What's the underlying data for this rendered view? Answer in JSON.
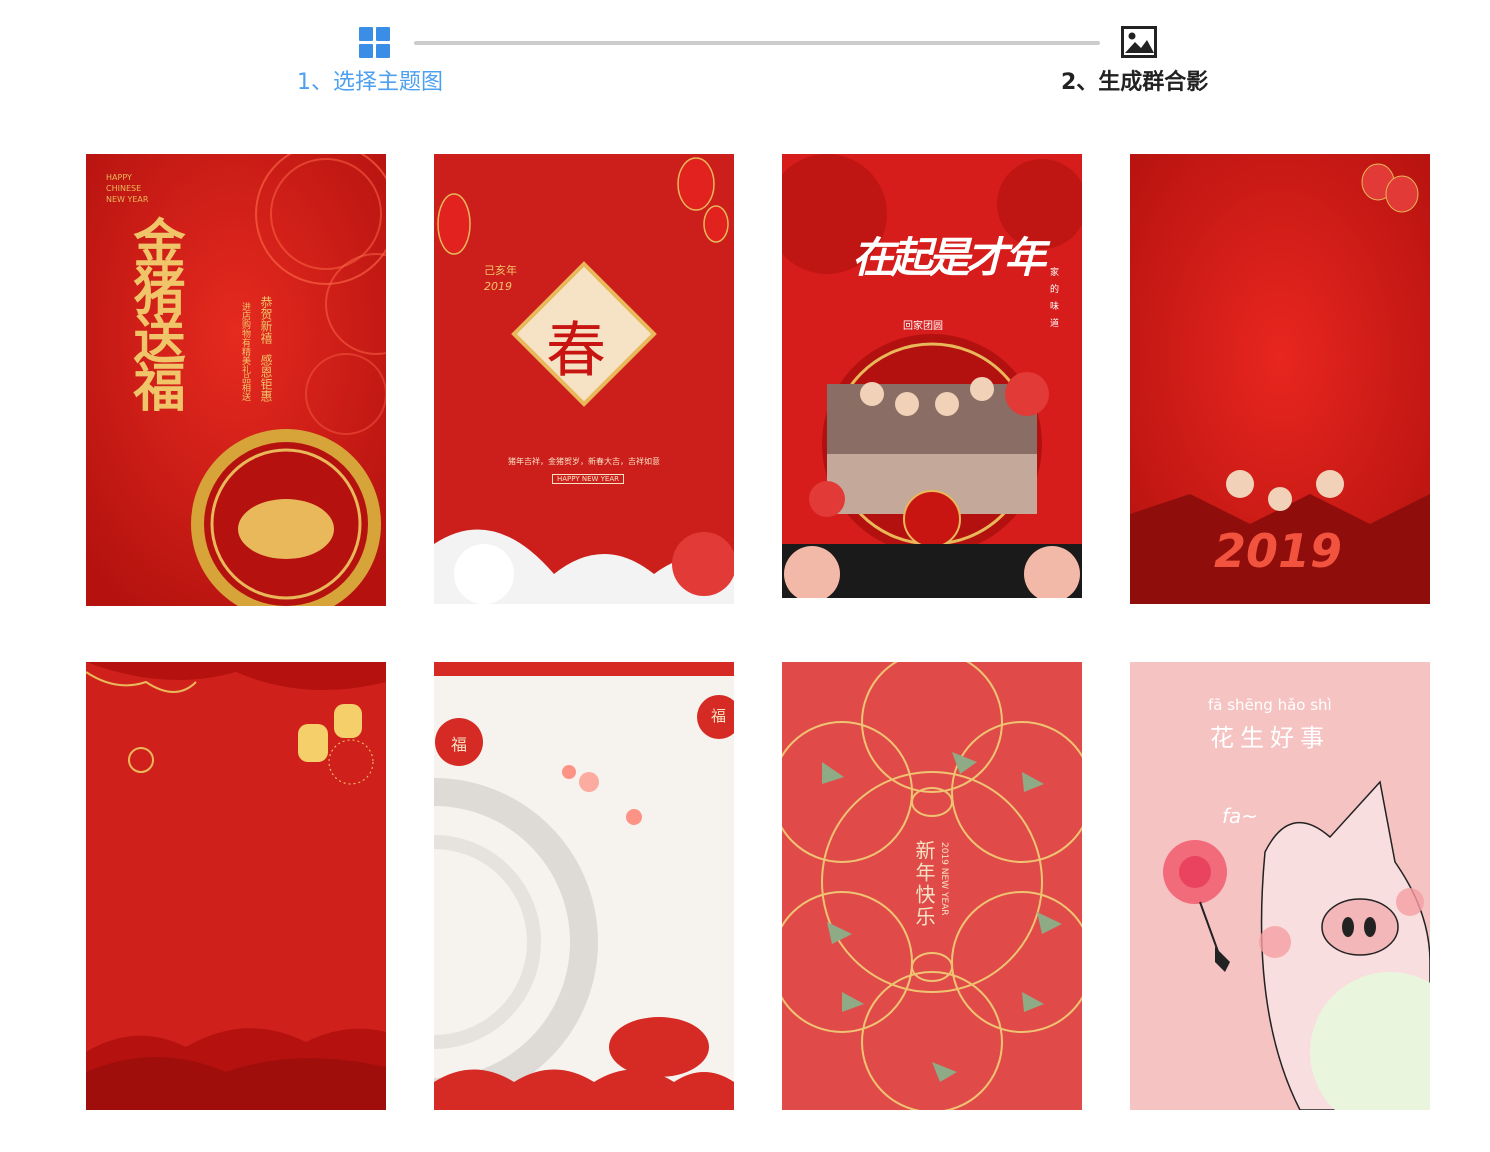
{
  "steps": {
    "step1": {
      "label": "1、选择主题图",
      "icon": "grid-icon",
      "color": "#4da0f0",
      "active": true
    },
    "step2": {
      "label": "2、生成群合影",
      "icon": "image-icon",
      "color": "#222222",
      "active": false
    }
  },
  "colors": {
    "accent": "#3a8ee6",
    "connector": "#cccccc",
    "festive_red": "#d8201d",
    "gold": "#e8b85a"
  },
  "templates": [
    {
      "name": "gold-pig-blessing",
      "headline": "金猪送福",
      "lines": [
        "恭贺新禧",
        "感恩钜惠",
        "进店购物有精美礼品相送"
      ],
      "tag": "HAPPY CHINESE NEW YEAR"
    },
    {
      "name": "spring-character",
      "headline": "春",
      "year_label": "己亥年",
      "year": "2019",
      "caption": "猪年吉祥，金猪贺岁，新春大吉，吉祥如意",
      "tag": "HAPPY NEW YEAR"
    },
    {
      "name": "family-reunion",
      "headline": "在起是才年",
      "subtitle": "回家团圆",
      "side": "家的味道"
    },
    {
      "name": "red-2019",
      "year": "2019"
    },
    {
      "name": "lantern-clouds"
    },
    {
      "name": "paper-cut-fu",
      "fu": "福"
    },
    {
      "name": "new-year-circles",
      "headline": "新年快乐",
      "tag": "2019 NEW YEAR"
    },
    {
      "name": "flower-pig",
      "pinyin": "fā shēng hǎo shì",
      "headline": "花生好事",
      "fa": "fa~"
    }
  ]
}
